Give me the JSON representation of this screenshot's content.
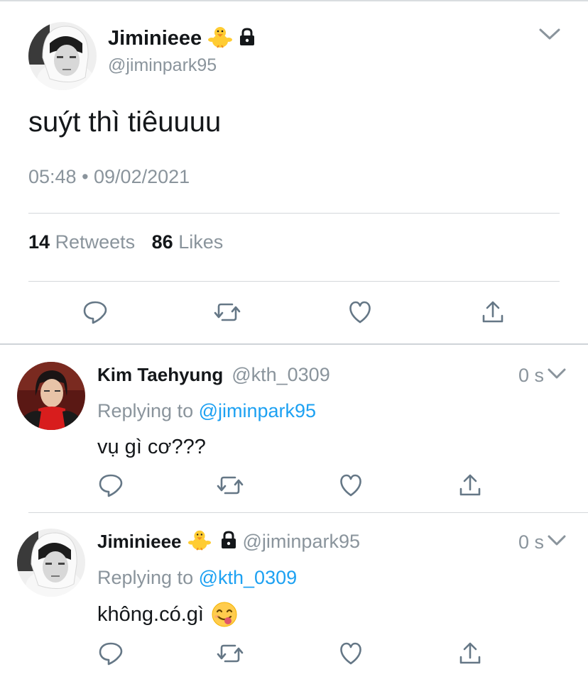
{
  "main_tweet": {
    "display_name": "Jiminieee",
    "handle": "@jiminpark95",
    "text": "suýt thì tiêuuuu",
    "timestamp": "05:48 • 09/02/2021",
    "retweets_count": "14",
    "retweets_label": "Retweets",
    "likes_count": "86",
    "likes_label": "Likes",
    "icons": [
      "chick-emoji",
      "lock-icon",
      "chevron-down-icon",
      "reply-icon",
      "retweet-icon",
      "like-icon",
      "share-icon"
    ]
  },
  "replies": [
    {
      "display_name": "Kim Taehyung",
      "handle": "@kth_0309",
      "time": "0 s",
      "replying_prefix": "Replying to",
      "replying_to": "@jiminpark95",
      "text": "vụ gì cơ???"
    },
    {
      "display_name": "Jiminieee",
      "handle": "@jiminpark95",
      "time": "0 s",
      "replying_prefix": "Replying to",
      "replying_to": "@kth_0309",
      "text": "không.có.gì"
    }
  ],
  "colors": {
    "text_primary": "#14171a",
    "text_secondary": "#8a949c",
    "link": "#1da1f2",
    "icon": "#657786",
    "divider": "#d4d8db"
  }
}
